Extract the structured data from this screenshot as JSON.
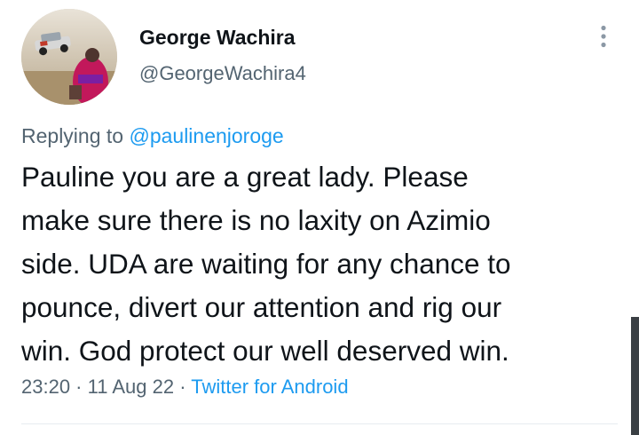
{
  "author": {
    "display_name": "George Wachira",
    "handle": "@GeorgeWachira4",
    "avatar_icon": "profile-photo"
  },
  "reply": {
    "prefix": "Replying to",
    "mention": "@paulinenjoroge"
  },
  "tweet": {
    "lines": [
      "Pauline you are a great lady. Please",
      "make sure there is no laxity on Azimio",
      "side. UDA are waiting for any chance to",
      "pounce, divert our attention and rig our",
      "win. God protect our well deserved win."
    ]
  },
  "meta": {
    "time": "23:20",
    "sep1": " · ",
    "date": "11 Aug 22",
    "sep2": " · ",
    "source": "Twitter for Android"
  },
  "colors": {
    "link": "#1d9bf0",
    "secondary_text": "#536471",
    "primary_text": "#0f1419"
  },
  "icons": {
    "more": "vertical-ellipsis-icon"
  }
}
